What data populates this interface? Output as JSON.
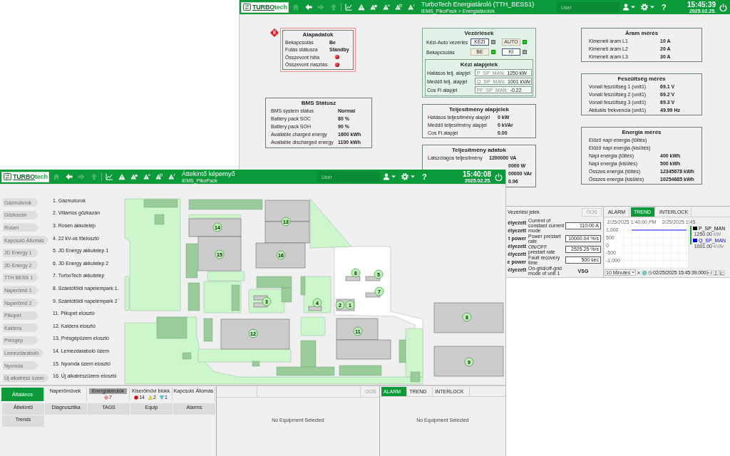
{
  "back_window": {
    "header": {
      "logo": [
        "TURBO",
        "tech"
      ],
      "nav": [
        {
          "kind": "home",
          "disabled": true
        },
        {
          "kind": "back",
          "disabled": false
        },
        {
          "kind": "forward",
          "disabled": true
        },
        {
          "kind": "up",
          "disabled": true
        }
      ],
      "title": "TurboTech Energiatároló (TTH_BESS1)",
      "breadcrumb": "iEMS_PikoPack > Energiatárolók",
      "user": "User",
      "help": "?",
      "time": "15:45:39",
      "date": "2025.02.25."
    },
    "alapadatok": {
      "badge": "E",
      "title": "Alapadatok",
      "rows": [
        {
          "kind": "value",
          "label": "Bekapcsolás",
          "value": "Be"
        },
        {
          "kind": "value",
          "label": "Futás státusza",
          "value": "Standby"
        },
        {
          "kind": "lamp",
          "label": "Összevont hiba",
          "active": true
        },
        {
          "kind": "lamp",
          "label": "Összevont riasztás",
          "active": true
        }
      ]
    },
    "bms_status": {
      "title": "BMS Státusz",
      "rows": [
        {
          "label": "BMS system status",
          "value": "Normal"
        },
        {
          "label": "Battery pack SOC",
          "value": "80 %"
        },
        {
          "label": "Battery pack SOH",
          "value": "90 %"
        },
        {
          "label": "Available charged energy",
          "value": "1600 kWh"
        },
        {
          "label": "Available discharged energy",
          "value": "1100 kWh"
        }
      ]
    },
    "vezerlesek": {
      "title": "Vezérlések",
      "switches": [
        {
          "label": "Kézi-Auto vezérlés",
          "buttons": [
            {
              "label": "KÉZI",
              "on": false
            },
            {
              "label": "AUTO",
              "on": true
            }
          ]
        },
        {
          "label": "Bekapcsolás",
          "buttons": [
            {
              "label": "BE",
              "on": true
            },
            {
              "label": "KI",
              "on": false
            }
          ]
        }
      ],
      "setpoints": {
        "title": "Kézi alapjelek",
        "rows": [
          {
            "label": "Hatásos telj. alapjel",
            "tag": "P_SP_MAN:",
            "value": "1250 kW"
          },
          {
            "label": "Meddő telj. alapjel",
            "tag": "Q_SP_MAN:",
            "value": "1001 kVAr"
          },
          {
            "label": "Cos Fi alapjel",
            "tag": "PF_SP_MAN:",
            "value": "-0.22"
          }
        ]
      }
    },
    "teljesitmeny_alapjelek": {
      "title": "Teljesítmény alapjelek",
      "rows": [
        {
          "label": "Hatásos teljesítmény alapjel",
          "value": "0 kW"
        },
        {
          "label": "Meddő teljesítmény alapjel",
          "value": "0 kVAr"
        },
        {
          "label": "Cos Fi alapjel",
          "value": "0.00"
        }
      ]
    },
    "teljesitmeny_adatok": {
      "title": "Teljesítmény adatok",
      "rows": [
        {
          "label": "Látszólagos teljesítmény",
          "value": "1200000 VA"
        },
        {
          "value": "0000 W"
        },
        {
          "value": "00000 VAr"
        },
        {
          "value": "0.96"
        }
      ]
    },
    "aram_meres": {
      "title": "Áram mérés",
      "rows": [
        {
          "label": "Kimeneti áram L1",
          "value": "10 A"
        },
        {
          "label": "Kimeneti áram L2",
          "value": "20 A"
        },
        {
          "label": "Kimeneti áram L3",
          "value": "30 A"
        }
      ]
    },
    "feszultseg_meres": {
      "title": "Feszültség mérés",
      "rows": [
        {
          "label": "Vonali feszültség 1 (unit1)",
          "value": "69.1 V"
        },
        {
          "label": "Vonali feszültség 2 (unit1)",
          "value": "69.2 V"
        },
        {
          "label": "Vonali feszültség 3 (unit1)",
          "value": "69.3 V"
        },
        {
          "label": "Aktuális frekvencia (unit1)",
          "value": "49.99 Hz"
        }
      ]
    },
    "energia_meres": {
      "title": "Energia mérés",
      "rows": [
        {
          "label": "Előző napi energia (töltés)"
        },
        {
          "label": "Előző napi energia (kisütés)"
        },
        {
          "label": "Napi energia (töltés)",
          "value": "400 kWh"
        },
        {
          "label": "Napi energia (kisütés)",
          "value": "500 kWh"
        },
        {
          "label": "Összes energia (töltés)",
          "value": "12345678 kWh"
        },
        {
          "label": "Összes energia (kisütés)",
          "value": "10254685 kWh"
        }
      ]
    },
    "control_signals": {
      "title": "Vezérlési jelek",
      "oos": "OOS",
      "cut_texts": [
        "élyezett",
        "élyezett",
        "t power",
        "élyezett",
        "élyezett",
        "e power",
        "élyezett"
      ],
      "rows": [
        {
          "kind": "field",
          "label": "Current of constant current mode",
          "value": "110.00 A"
        },
        {
          "kind": "field",
          "label": "Power prestart rate",
          "value": "10000.04 %/s"
        },
        {
          "kind": "field",
          "label": "ON/OFF prestart rate",
          "value": "2525.25 %/s"
        },
        {
          "kind": "field",
          "label": "Fault recovery time",
          "value": "500 sec"
        },
        {
          "kind": "text",
          "label": "On-grid/off-grid mode of unit 1",
          "value": "VSG"
        }
      ]
    },
    "trend": {
      "tabs": [
        {
          "label": "ALARM",
          "selected": false
        },
        {
          "label": "TREND",
          "selected": true
        },
        {
          "label": "INTERLOCK",
          "selected": false
        }
      ],
      "chart_data": {
        "type": "line",
        "categories": [
          null,
          null,
          null,
          "2/25/2025 1:40:00 PM",
          null,
          null,
          null,
          null,
          null,
          "2/25/2025 1:45",
          null
        ],
        "ylim": [
          -1500,
          1800
        ],
        "yticks": [
          {
            "value": 1000,
            "label": "1,000"
          },
          {
            "value": 500,
            "label": "500"
          },
          0,
          {
            "value": -500,
            "label": "-500"
          },
          {
            "value": -1000,
            "label": "-1,000"
          }
        ],
        "grid": true,
        "series": [
          {
            "name": "P_SP_MAN",
            "color": "#000000",
            "values": [
              null,
              null,
              null,
              null,
              null,
              null,
              null,
              null,
              null,
              null,
              null
            ]
          },
          {
            "name": "Q_SP_MAN",
            "color": "#0000ff",
            "values": [
              null,
              null,
              null,
              1000,
              1000,
              1000,
              1000,
              1000,
              1000,
              1000,
              1000
            ]
          }
        ]
      },
      "legend": [
        {
          "value": "1250.00",
          "unit": "kW"
        },
        {
          "value": "1001.00",
          "unit": "kVAr"
        }
      ],
      "range": "10 Minutes",
      "time": "02/25/2025 15:45:39.000"
    }
  },
  "front_window": {
    "header": {
      "logo": [
        "TURBO",
        "tech"
      ],
      "nav": [
        {
          "kind": "home",
          "disabled": true
        },
        {
          "kind": "back",
          "disabled": false
        },
        {
          "kind": "forward",
          "disabled": true
        },
        {
          "kind": "up",
          "disabled": true
        }
      ],
      "title": "Áttekintő képernyő",
      "breadcrumb": "iEMS_PikoPack",
      "user": "User",
      "help": "?",
      "time": "15:40:08",
      "date": "2025.02.25."
    },
    "sites": [
      {
        "button": "Gázmotorok",
        "description": "1. Gázmotorok"
      },
      {
        "button": "Gőzkazán",
        "description": "2. Villamos gőzkazán"
      },
      {
        "button": "Rosen",
        "description": "3. Rosen akkutelep"
      },
      {
        "button": "Kapcsoló Állomás",
        "description": "4. 22 kV-os főelosztó"
      },
      {
        "button": "JD Energy 1",
        "description": "5. JD Energy akkutelep 1"
      },
      {
        "button": "JD Energy 2",
        "description": "6. JD Energy akkutelep 2"
      },
      {
        "button": "TTH BESS 1",
        "description": "7. TurboTech akkutelep"
      },
      {
        "button": "Naperőmű 1",
        "description": "8. Szántóföldi napelempark 1."
      },
      {
        "button": "Naperőmű 2",
        "description": "9. Szántóföldi napelempark 2"
      },
      {
        "button": "Pikopet",
        "description": "11. Pikopet elosztó"
      },
      {
        "button": "Kaldera",
        "description": "12. Kaldera elosztó"
      },
      {
        "button": "Présgép",
        "description": "13. Présgépüzem elosztó"
      },
      {
        "button": "Lemezdaraboló",
        "description": "14. Lemezdaraboló üzem"
      },
      {
        "button": "Nyomda",
        "description": "15. Nyomda üzem elosztó"
      },
      {
        "button": "Új alkatrész üzem",
        "description": "16. Új alkatrészüzem elosztó"
      }
    ],
    "map": {
      "markers": [
        {
          "label": "13"
        },
        {
          "label": "14"
        },
        {
          "label": "15"
        },
        {
          "label": "16"
        },
        {
          "label": "6"
        },
        {
          "label": "5"
        },
        {
          "label": "7"
        },
        {
          "label": "3"
        },
        {
          "label": "4"
        },
        {
          "label": "2"
        },
        {
          "label": "1"
        },
        {
          "label": "8"
        },
        {
          "label": "11"
        },
        {
          "label": "12"
        },
        {
          "label": "9"
        }
      ]
    },
    "nav_panel": {
      "tabs": [
        {
          "label": "Általános",
          "selected": true,
          "highlighted": false
        },
        {
          "label": "Naperőművek",
          "selected": false,
          "highlighted": false
        },
        {
          "label": "Energiatárolók",
          "selected": false,
          "highlighted": true,
          "alarms": [
            {
              "kind": "diamond",
              "count": "7"
            }
          ]
        },
        {
          "label": "Kiserőművi blokk",
          "selected": false,
          "highlighted": false,
          "alarms": [
            {
              "kind": "dot",
              "count": "14"
            },
            {
              "kind": "triangle",
              "count": "2"
            },
            {
              "kind": "funnel",
              "count": "1"
            }
          ]
        },
        {
          "label": "Kapcsoló Állomás",
          "selected": false,
          "highlighted": false
        }
      ],
      "buttons": [
        "Áttekintő",
        "Diagnosztika",
        "TAGS",
        "Equip",
        "Alarms",
        "Trends"
      ]
    },
    "equipment_panel": {
      "oos": "OOS",
      "message": "No Equipment Selected"
    },
    "detail_panel": {
      "tabs": [
        {
          "label": "ALARM",
          "selected": true
        },
        {
          "label": "TREND",
          "selected": false
        },
        {
          "label": "INTERLOCK",
          "selected": false
        }
      ],
      "message": "No Equipment Selected"
    }
  }
}
